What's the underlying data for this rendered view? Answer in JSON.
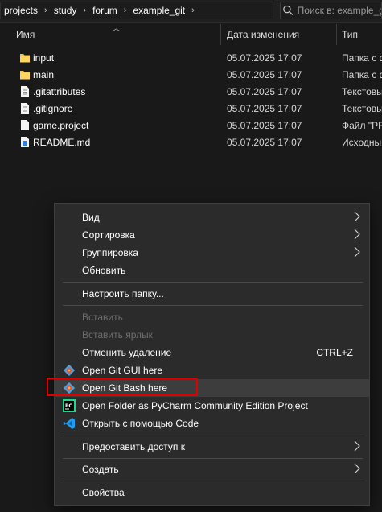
{
  "breadcrumb": [
    "projects",
    "study",
    "forum",
    "example_git"
  ],
  "search": {
    "placeholder": "Поиск в: example_git"
  },
  "columns": {
    "name": "Имя",
    "date": "Дата изменения",
    "type": "Тип"
  },
  "files": [
    {
      "name": "input",
      "date": "05.07.2025 17:07",
      "type": "Папка с ф",
      "icon": "folder-icon"
    },
    {
      "name": "main",
      "date": "05.07.2025 17:07",
      "type": "Папка с ф",
      "icon": "folder-icon"
    },
    {
      "name": ".gitattributes",
      "date": "05.07.2025 17:07",
      "type": "Текстовы",
      "icon": "text-file-icon"
    },
    {
      "name": ".gitignore",
      "date": "05.07.2025 17:07",
      "type": "Текстовы",
      "icon": "text-file-icon"
    },
    {
      "name": "game.project",
      "date": "05.07.2025 17:07",
      "type": "Файл \"PR",
      "icon": "file-icon"
    },
    {
      "name": "README.md",
      "date": "05.07.2025 17:07",
      "type": "Исходны",
      "icon": "markdown-file-icon"
    }
  ],
  "menu": {
    "view": "Вид",
    "sort": "Сортировка",
    "group": "Группировка",
    "refresh": "Обновить",
    "customize": "Настроить папку...",
    "paste": "Вставить",
    "paste_shortcut": "Вставить ярлык",
    "undo_delete": "Отменить удаление",
    "undo_shortcut": "CTRL+Z",
    "git_gui": "Open Git GUI here",
    "git_bash": "Open Git Bash here",
    "pycharm": "Open Folder as PyCharm Community Edition Project",
    "vscode": "Открыть с помощью Code",
    "share": "Предоставить доступ к",
    "create": "Создать",
    "properties": "Свойства"
  },
  "colors": {
    "highlight_box": "#e00000",
    "menu_bg": "#2b2b2b",
    "folder": "#f3c24a"
  }
}
